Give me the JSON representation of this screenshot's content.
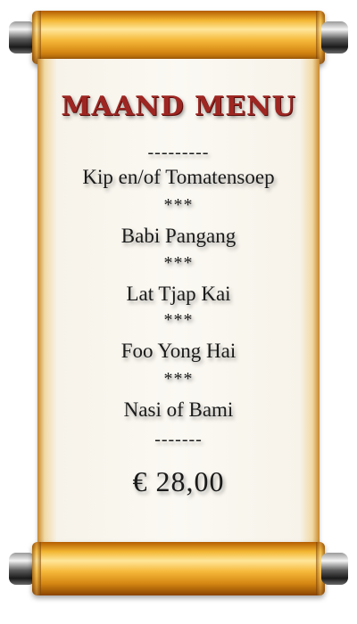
{
  "menu": {
    "title": "MAAND MENU",
    "separator_top": "---------",
    "items": [
      "Kip en/of Tomatensoep",
      "***",
      "Babi Pangang",
      "***",
      "Lat Tjap Kai",
      "***",
      "Foo Yong Hai",
      "***",
      "Nasi of Bami"
    ],
    "separator_bottom": "-------",
    "price": "€ 28,00"
  },
  "colors": {
    "title": "#9e2622",
    "text": "#1a1a1a",
    "gold": "#f3b632"
  }
}
